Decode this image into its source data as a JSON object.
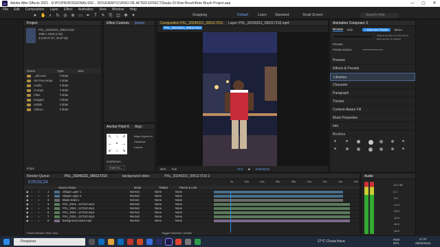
{
  "window": {
    "title": "Adobe After Effects 2021 - D:\\PC\\PROFISSIONAL\\202... DO\\UDEMY\\CURSO DE AFTER EFFECTS\\aula 23 Roto Brush\\Roto Brush Project.aep",
    "min": "—",
    "max": "▢",
    "close": "✕",
    "ae_badge": "Ae"
  },
  "menu": [
    "File",
    "Edit",
    "Composition",
    "Layer",
    "Effect",
    "Animation",
    "View",
    "Window",
    "Help"
  ],
  "toolbar": {
    "snapping": "Snapping",
    "workspaces": [
      "Default",
      "Learn",
      "Standard",
      "Small Screen"
    ],
    "search": "Search Help"
  },
  "project": {
    "tab": "Project",
    "comp_name": "PXL_20240221_095117210",
    "comp_info": "1080 x 1920 (1.00)",
    "comp_dur": "Δ 0;00;27;07, 29.97 fps",
    "header": [
      "Name",
      "Type",
      "Size"
    ],
    "items": [
      {
        "name": "_afCover",
        "type": "Folder"
      },
      {
        "name": "AE Precomps",
        "type": "Folder"
      },
      {
        "name": "Audio",
        "type": "Folder"
      },
      {
        "name": "Comps",
        "type": "Folder"
      },
      {
        "name": "Files",
        "type": "Folder"
      },
      {
        "name": "Images",
        "type": "Folder"
      },
      {
        "name": "Solids",
        "type": "Folder"
      },
      {
        "name": "Videos",
        "type": "Folder"
      }
    ],
    "bpc": "8 bpc"
  },
  "effect_controls": {
    "tab": "Effect Controls",
    "none": "(none)"
  },
  "anchor": {
    "tab": "Anchor Point 6",
    "align": "Align",
    "align_layers": "Align Layers to:",
    "distribute": "Distribute Layers:",
    "keyframes": "Keyframes",
    "insert": "Insert to..."
  },
  "composition": {
    "tab": "Composition",
    "comp_tab": "PXL_20240221_095117210",
    "layer_tab": "Layer: PXL_20240221_095117210.mp4",
    "breadcrumb": "PXL_20240221_095117210",
    "zoom": "25%",
    "quality": "Full",
    "exposure": "+0.0",
    "timecode": "0;00;02;24"
  },
  "right": {
    "title": "Animation Composer 3",
    "tabs": [
      "Browse",
      "Edit"
    ],
    "discover": "+ Discover Packs",
    "menu": "Menu",
    "hint": "Select an item on the left or type above to search",
    "presets": "Presets",
    "preset_actions": "Preset Actions",
    "items": [
      "Preview",
      "Effects & Presets",
      "Libraries",
      "Character",
      "Paragraph",
      "Tracker",
      "Content-Aware Fill",
      "Mask Properties",
      "Info"
    ],
    "brushes": "Brushes"
  },
  "timeline": {
    "tabs": [
      "Render Queue",
      "PXL_20240221_095117210",
      "background video",
      "PXL_20240221_095117210 2"
    ],
    "timecode": "0;00;02;24",
    "cols": [
      "Source Name",
      "Mode",
      "TrkMat",
      "Parent & Link"
    ],
    "layers": [
      {
        "n": "1",
        "name": "Shape Layer 1",
        "mode": "Normal",
        "trk": "None",
        "parent": "None"
      },
      {
        "n": "2",
        "name": "Shape Layer 2",
        "mode": "Normal",
        "trk": "None",
        "parent": "None"
      },
      {
        "n": "3",
        "name": "Black Solid 1",
        "mode": "Screen",
        "trk": "None",
        "parent": "None"
      },
      {
        "n": "4",
        "name": "PXL_2024...117210.mp4",
        "mode": "Normal",
        "trk": "None",
        "parent": "None"
      },
      {
        "n": "5",
        "name": "PXL_2024...117210.mp4",
        "mode": "Normal",
        "trk": "None",
        "parent": "None"
      },
      {
        "n": "6",
        "name": "PXL_2024...117210.mp4",
        "mode": "Normal",
        "trk": "None",
        "parent": "None"
      },
      {
        "n": "7",
        "name": "PXL_2024...117210.mp4",
        "mode": "Normal",
        "trk": "None",
        "parent": "None"
      },
      {
        "n": "8",
        "name": "background video.mp4",
        "mode": "Normal",
        "trk": "None",
        "parent": "None"
      }
    ],
    "ruler": [
      "0s",
      "02s",
      "04s",
      "06s",
      "08s",
      "10s",
      "12s",
      "14s",
      "16s"
    ],
    "frame_render": "Frame Render Time: 0ms",
    "toggle": "Toggle Switches / Modes"
  },
  "audio": {
    "tab": "Audio",
    "levels": [
      "12.0 dB",
      "0.0",
      "-6.0",
      "-12.0",
      "-18.0",
      "-24.0",
      "-30.0",
      "-36.0"
    ]
  },
  "taskbar": {
    "search": "Pesquisar",
    "weather": "27°C  Chuva fraca",
    "lang": "POR\nINTL",
    "time": "17:27",
    "date": "29/02/2024"
  },
  "colors": {
    "accent": "#2d8ceb",
    "comp_tab": "#e8c547"
  }
}
